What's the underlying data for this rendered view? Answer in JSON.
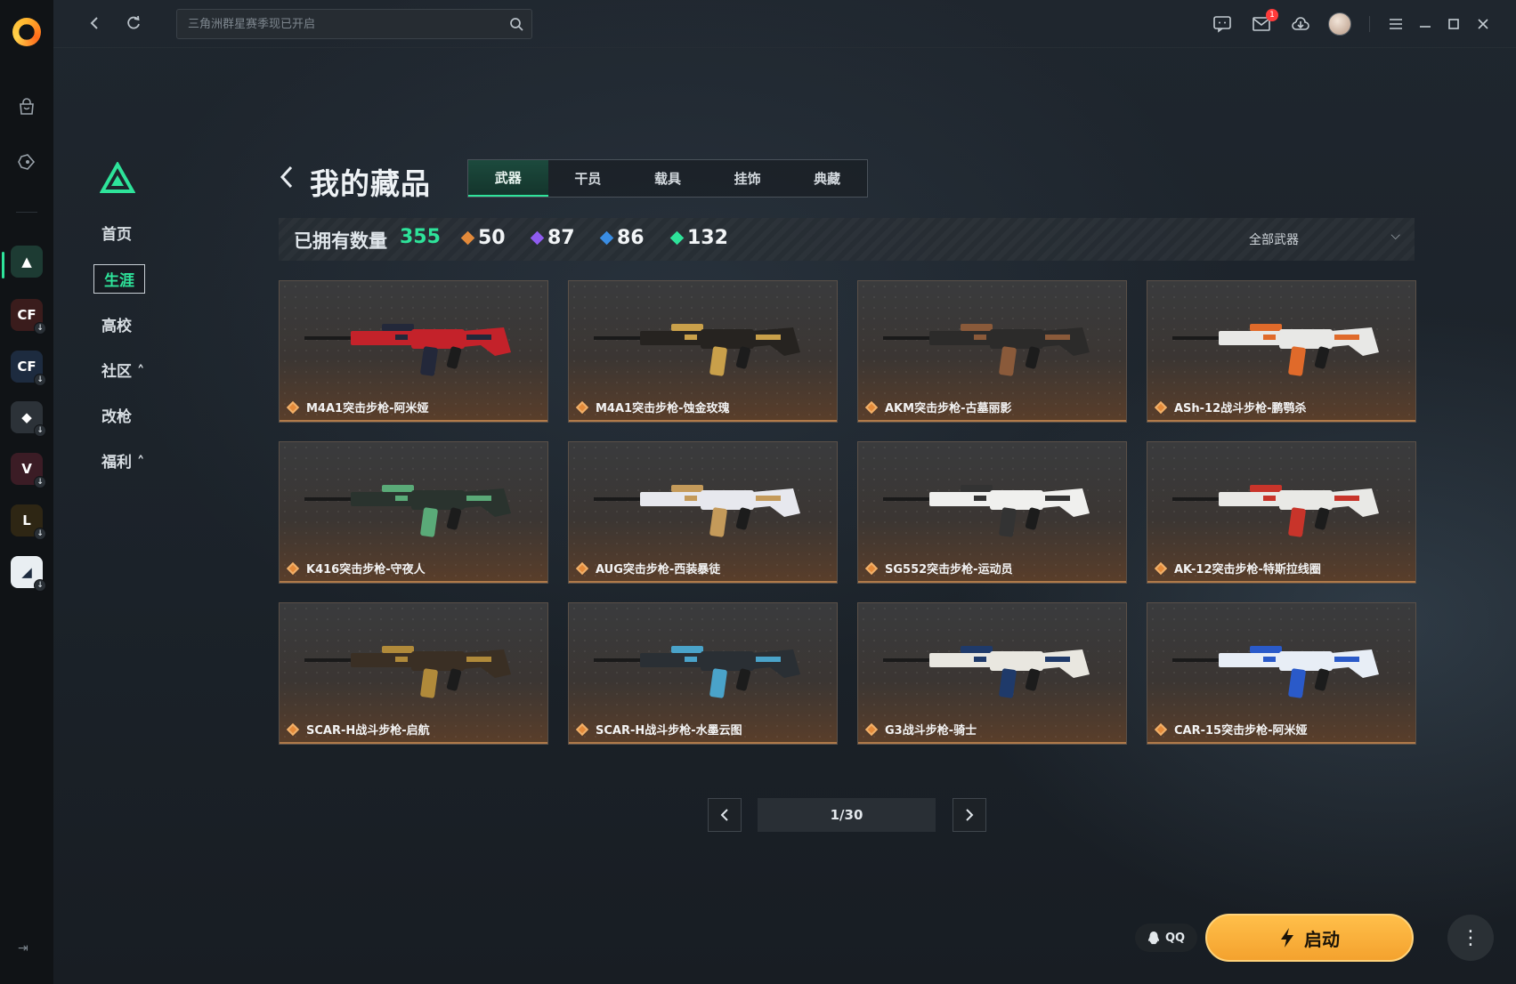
{
  "topbar": {
    "search_placeholder": "三角洲群星赛季现已开启",
    "mail_badge": "1",
    "icons": [
      "back-arrow-icon",
      "refresh-icon",
      "search-icon",
      "chat-icon",
      "mail-icon",
      "download-icon",
      "avatar",
      "menu-icon",
      "minimize-icon",
      "maximize-icon",
      "close-icon"
    ]
  },
  "app_rail": {
    "icons": [
      "logo",
      "shop-icon",
      "game-controller-icon"
    ],
    "games": [
      {
        "name": "三角洲行动",
        "color": "#1d3b33",
        "abbr": "▲"
      },
      {
        "name": "穿越火线",
        "color": "#3a1c1c",
        "abbr": "CF"
      },
      {
        "name": "穿越火线HD",
        "color": "#1d2b3f",
        "abbr": "CF"
      },
      {
        "name": "暗区突围",
        "color": "#2c3238",
        "abbr": "◆"
      },
      {
        "name": "无畏契约",
        "color": "#3b1c25",
        "abbr": "V"
      },
      {
        "name": "英雄联盟",
        "color": "#2e2614",
        "abbr": "L"
      },
      {
        "name": "战争雷霆",
        "color": "#e9eef2",
        "abbr": "◢"
      }
    ]
  },
  "game_nav": {
    "items": [
      {
        "label": "首页"
      },
      {
        "label": "生涯",
        "active": true
      },
      {
        "label": "高校"
      },
      {
        "label": "社区 ˄"
      },
      {
        "label": "改枪"
      },
      {
        "label": "福利 ˄"
      }
    ]
  },
  "page": {
    "title": "我的藏品",
    "tabs": [
      {
        "label": "武器",
        "active": true
      },
      {
        "label": "干员"
      },
      {
        "label": "载具"
      },
      {
        "label": "挂饰"
      },
      {
        "label": "典藏"
      }
    ]
  },
  "stats": {
    "label": "已拥有数量",
    "total": "355",
    "rarities": [
      {
        "value": "50",
        "color": "#e38a3a"
      },
      {
        "value": "87",
        "color": "#8f5cf0"
      },
      {
        "value": "86",
        "color": "#3a8de3"
      },
      {
        "value": "132",
        "color": "#2ee39a"
      }
    ],
    "filter_label": "全部武器"
  },
  "weapons": [
    {
      "name": "M4A1突击步枪-阿米娅",
      "body": "#c4222a",
      "accent": "#23283a"
    },
    {
      "name": "M4A1突击步枪-蚀金玫瑰",
      "body": "#262320",
      "accent": "#c9a04a"
    },
    {
      "name": "AKM突击步枪-古墓丽影",
      "body": "#2c2b2a",
      "accent": "#8a5a3a"
    },
    {
      "name": "ASh-12战斗步枪-鹏鹗杀",
      "body": "#e8e8e6",
      "accent": "#e06a2a"
    },
    {
      "name": "K416突击步枪-守夜人",
      "body": "#2a332e",
      "accent": "#5aaa78"
    },
    {
      "name": "AUG突击步枪-西装暴徒",
      "body": "#e7e8ee",
      "accent": "#c49a5a"
    },
    {
      "name": "SG552突击步枪-运动员",
      "body": "#f0f0ee",
      "accent": "#333333"
    },
    {
      "name": "AK-12突击步枪-特斯拉线圈",
      "body": "#e9e9e6",
      "accent": "#c8342a"
    },
    {
      "name": "SCAR-H战斗步枪-启航",
      "body": "#3a2f24",
      "accent": "#b08a3a"
    },
    {
      "name": "SCAR-H战斗步枪-水墨云图",
      "body": "#2a2f34",
      "accent": "#4aa3c9"
    },
    {
      "name": "G3战斗步枪-骑士",
      "body": "#e9e7e0",
      "accent": "#1f3a6a"
    },
    {
      "name": "CAR-15突击步枪-阿米娅",
      "body": "#e8eef6",
      "accent": "#2a5ac9"
    }
  ],
  "pagination": {
    "label": "1/30"
  },
  "footer": {
    "qq_label": "QQ",
    "launch_label": "启动"
  },
  "colors": {
    "accent": "#2ee39a",
    "launch": "#f7aa32",
    "rarity_gold": "#e38a3a"
  }
}
